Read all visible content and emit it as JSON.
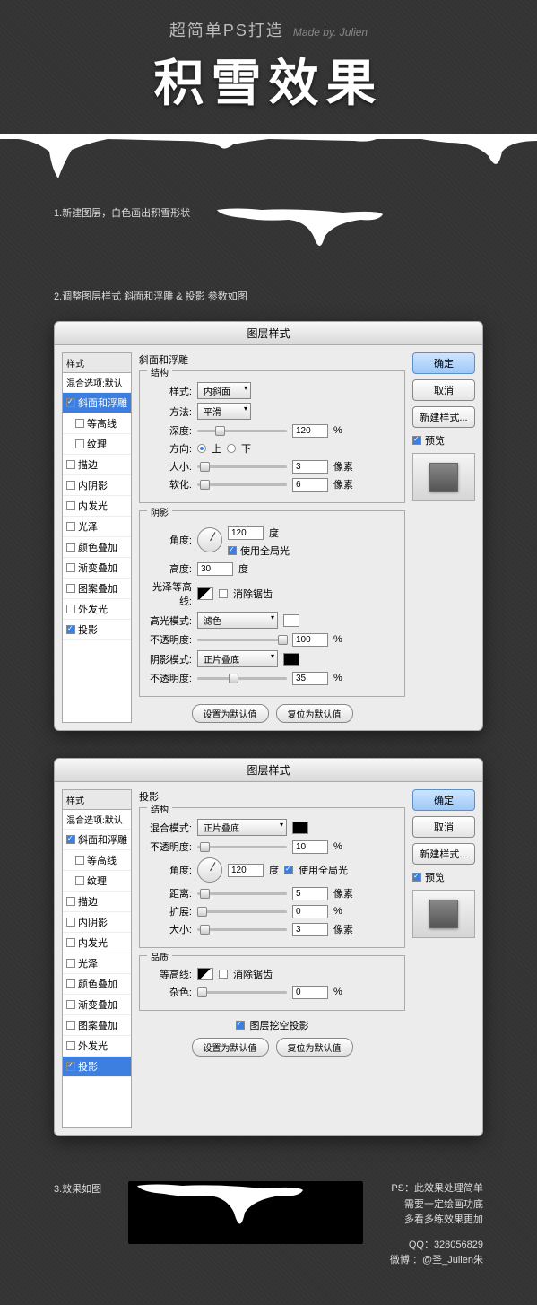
{
  "header": {
    "sub": "超简单PS打造",
    "made": "Made by. Julien",
    "title": "积雪效果"
  },
  "steps": {
    "s1": "1.新建图层，白色画出积雪形状",
    "s2": "2.调整图层样式 斜面和浮雕 & 投影 参数如图",
    "s3": "3.效果如图"
  },
  "dlg": {
    "title": "图层样式"
  },
  "styles": {
    "hdr": "样式",
    "blend": "混合选项:默认",
    "items": [
      "斜面和浮雕",
      "等高线",
      "纹理",
      "描边",
      "内阴影",
      "内发光",
      "光泽",
      "颜色叠加",
      "渐变叠加",
      "图案叠加",
      "外发光",
      "投影"
    ]
  },
  "side": {
    "ok": "确定",
    "cancel": "取消",
    "new": "新建样式...",
    "preview": "预览"
  },
  "bevel": {
    "title": "斜面和浮雕",
    "struct": "结构",
    "shadow": "阴影",
    "style": "样式:",
    "style_v": "内斜面",
    "method": "方法:",
    "method_v": "平滑",
    "depth": "深度:",
    "depth_v": "120",
    "dir": "方向:",
    "up": "上",
    "down": "下",
    "size": "大小:",
    "size_v": "3",
    "px": "像素",
    "soft": "软化:",
    "soft_v": "6",
    "angle": "角度:",
    "angle_v": "120",
    "deg": "度",
    "global": "使用全局光",
    "alt": "高度:",
    "alt_v": "30",
    "contour": "光泽等高线:",
    "anti": "消除锯齿",
    "hmode": "高光模式:",
    "hmode_v": "滤色",
    "hopac": "不透明度:",
    "hopac_v": "100",
    "smode": "阴影模式:",
    "smode_v": "正片叠底",
    "sopac": "不透明度:",
    "sopac_v": "35",
    "default": "设置为默认值",
    "reset": "复位为默认值"
  },
  "shadow": {
    "title": "投影",
    "struct": "结构",
    "qual": "品质",
    "bmode": "混合模式:",
    "bmode_v": "正片叠底",
    "opac": "不透明度:",
    "opac_v": "10",
    "angle": "角度:",
    "angle_v": "120",
    "deg": "度",
    "global": "使用全局光",
    "dist": "距离:",
    "dist_v": "5",
    "px": "像素",
    "spread": "扩展:",
    "spread_v": "0",
    "size": "大小:",
    "size_v": "3",
    "contour": "等高线:",
    "anti": "消除锯齿",
    "noise": "杂色:",
    "noise_v": "0",
    "knock": "图层挖空投影",
    "default": "设置为默认值",
    "reset": "复位为默认值"
  },
  "footer": {
    "ps": "PS：此效果处理简单\n需要一定绘画功底\n多看多练效果更加",
    "qq": "QQ：328056829",
    "weibo": "微博 ：@圣_Julien朱"
  }
}
